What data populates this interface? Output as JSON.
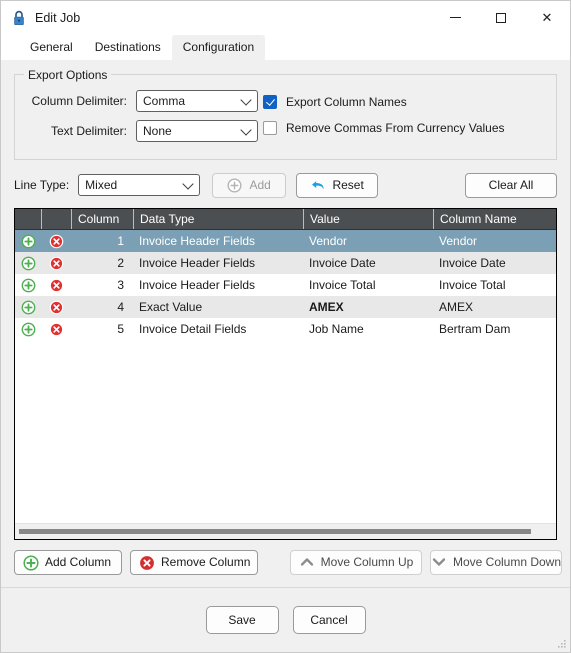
{
  "window": {
    "title": "Edit Job",
    "icon": "lock-icon",
    "controls": {
      "minimize": "—",
      "maximize": "□",
      "close": "✕"
    }
  },
  "tabs": [
    {
      "label": "General",
      "active": false
    },
    {
      "label": "Destinations",
      "active": false
    },
    {
      "label": "Configuration",
      "active": true
    }
  ],
  "export_options": {
    "legend": "Export Options",
    "fields": [
      {
        "label": "Column Delimiter:",
        "value": "Comma"
      },
      {
        "label": "Text Delimiter:",
        "value": "None"
      }
    ],
    "checkboxes": [
      {
        "label": "Export Column Names",
        "checked": true
      },
      {
        "label": "Remove Commas From Currency Values",
        "checked": false
      }
    ]
  },
  "line_type_bar": {
    "label": "Line Type:",
    "value": "Mixed",
    "add_label": "Add",
    "add_disabled": true,
    "reset_label": "Reset",
    "clear_all_label": "Clear All"
  },
  "grid": {
    "headers": [
      "",
      "",
      "Column",
      "Data Type",
      "Value",
      "Column Name"
    ],
    "rows": [
      {
        "column": "1",
        "data_type": "Invoice Header Fields",
        "value": "Vendor",
        "column_name": "Vendor",
        "selected": true,
        "bold_value": false
      },
      {
        "column": "2",
        "data_type": "Invoice Header Fields",
        "value": "Invoice Date",
        "column_name": "Invoice Date",
        "selected": false,
        "bold_value": false
      },
      {
        "column": "3",
        "data_type": "Invoice Header Fields",
        "value": "Invoice Total",
        "column_name": "Invoice Total",
        "selected": false,
        "bold_value": false
      },
      {
        "column": "4",
        "data_type": "Exact Value",
        "value": "AMEX",
        "column_name": "AMEX",
        "selected": false,
        "bold_value": true
      },
      {
        "column": "5",
        "data_type": "Invoice Detail Fields",
        "value": "Job Name",
        "column_name": "Bertram Dam",
        "selected": false,
        "bold_value": false
      }
    ],
    "row_icons": {
      "add": "green-plus-circle-icon",
      "remove": "red-x-circle-icon"
    }
  },
  "column_actions": [
    {
      "label": "Add Column",
      "icon": "green-plus-circle-icon"
    },
    {
      "label": "Remove Column",
      "icon": "red-x-circle-icon"
    },
    {
      "label": "Move Column Up",
      "icon": "chevron-up-icon"
    },
    {
      "label": "Move Column Down",
      "icon": "chevron-down-icon"
    }
  ],
  "footer": {
    "save_label": "Save",
    "cancel_label": "Cancel"
  },
  "colors": {
    "header_bg": "#4b4f52",
    "selected_row": "#7ba0b5",
    "alt_row": "#e8e8e8",
    "accent_blue": "#0f62c4",
    "icon_green": "#4caf50",
    "icon_red": "#e03030",
    "reset_cyan": "#1ba1e2"
  }
}
